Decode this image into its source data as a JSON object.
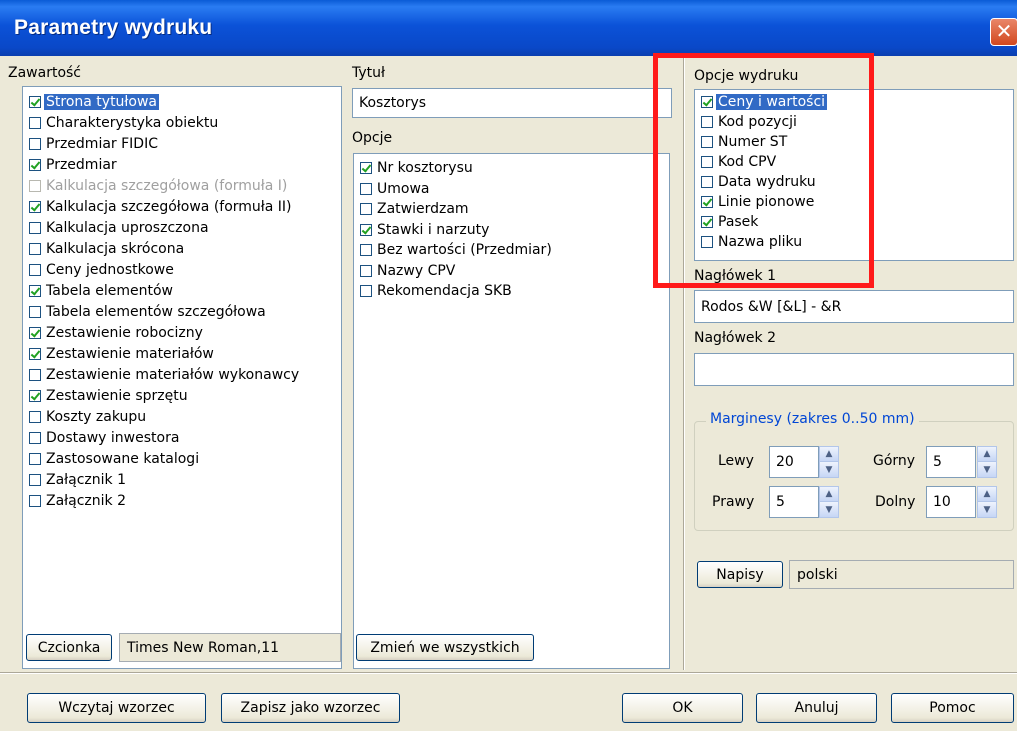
{
  "window": {
    "title": "Parametry wydruku",
    "close_glyph": "✕"
  },
  "zawartosc": {
    "label": "Zawartość",
    "items": [
      {
        "label": "Strona tytułowa",
        "checked": true,
        "selected": true,
        "disabled": false
      },
      {
        "label": "Charakterystyka obiektu",
        "checked": false,
        "selected": false,
        "disabled": false
      },
      {
        "label": "Przedmiar FIDIC",
        "checked": false,
        "selected": false,
        "disabled": false
      },
      {
        "label": "Przedmiar",
        "checked": true,
        "selected": false,
        "disabled": false
      },
      {
        "label": "Kalkulacja szczegółowa (formuła I)",
        "checked": false,
        "selected": false,
        "disabled": true
      },
      {
        "label": "Kalkulacja szczegółowa (formuła II)",
        "checked": true,
        "selected": false,
        "disabled": false
      },
      {
        "label": "Kalkulacja uproszczona",
        "checked": false,
        "selected": false,
        "disabled": false
      },
      {
        "label": "Kalkulacja skrócona",
        "checked": false,
        "selected": false,
        "disabled": false
      },
      {
        "label": "Ceny jednostkowe",
        "checked": false,
        "selected": false,
        "disabled": false
      },
      {
        "label": "Tabela elementów",
        "checked": true,
        "selected": false,
        "disabled": false
      },
      {
        "label": "Tabela elementów szczegółowa",
        "checked": false,
        "selected": false,
        "disabled": false
      },
      {
        "label": "Zestawienie robocizny",
        "checked": true,
        "selected": false,
        "disabled": false
      },
      {
        "label": "Zestawienie materiałów",
        "checked": true,
        "selected": false,
        "disabled": false
      },
      {
        "label": "Zestawienie materiałów wykonawcy",
        "checked": false,
        "selected": false,
        "disabled": false
      },
      {
        "label": "Zestawienie sprzętu",
        "checked": true,
        "selected": false,
        "disabled": false
      },
      {
        "label": "Koszty zakupu",
        "checked": false,
        "selected": false,
        "disabled": false
      },
      {
        "label": "Dostawy inwestora",
        "checked": false,
        "selected": false,
        "disabled": false
      },
      {
        "label": "Zastosowane katalogi",
        "checked": false,
        "selected": false,
        "disabled": false
      },
      {
        "label": "Załącznik 1",
        "checked": false,
        "selected": false,
        "disabled": false
      },
      {
        "label": "Załącznik 2",
        "checked": false,
        "selected": false,
        "disabled": false
      }
    ]
  },
  "tytul": {
    "label": "Tytuł",
    "value": "Kosztorys"
  },
  "opcje": {
    "label": "Opcje",
    "items": [
      {
        "label": "Nr kosztorysu",
        "checked": true
      },
      {
        "label": "Umowa",
        "checked": false
      },
      {
        "label": "Zatwierdzam",
        "checked": false
      },
      {
        "label": "Stawki i narzuty",
        "checked": true
      },
      {
        "label": "Bez wartości (Przedmiar)",
        "checked": false
      },
      {
        "label": "Nazwy CPV",
        "checked": false
      },
      {
        "label": "Rekomendacja SKB",
        "checked": false
      }
    ]
  },
  "opcje_wydruku": {
    "label": "Opcje wydruku",
    "items": [
      {
        "label": "Ceny i wartości",
        "checked": true,
        "selected": true
      },
      {
        "label": "Kod pozycji",
        "checked": false,
        "selected": false
      },
      {
        "label": "Numer ST",
        "checked": false,
        "selected": false
      },
      {
        "label": "Kod CPV",
        "checked": false,
        "selected": false
      },
      {
        "label": "Data wydruku",
        "checked": false,
        "selected": false
      },
      {
        "label": "Linie pionowe",
        "checked": true,
        "selected": false
      },
      {
        "label": "Pasek",
        "checked": true,
        "selected": false
      },
      {
        "label": "Nazwa pliku",
        "checked": false,
        "selected": false
      }
    ]
  },
  "naglowek1": {
    "label": "Nagłówek 1",
    "value": "Rodos &W [&L] - &R"
  },
  "naglowek2": {
    "label": "Nagłówek 2",
    "value": ""
  },
  "marginesy": {
    "title": "Marginesy (zakres 0..50 mm)",
    "lewy_label": "Lewy",
    "lewy_value": "20",
    "gorny_label": "Górny",
    "gorny_value": "5",
    "prawy_label": "Prawy",
    "prawy_value": "5",
    "dolny_label": "Dolny",
    "dolny_value": "10"
  },
  "napisy": {
    "button_label": "Napisy",
    "value": "polski"
  },
  "font": {
    "button_label": "Czcionka",
    "value": "Times New Roman,11"
  },
  "zmien_label": "Zmień we wszystkich",
  "footer": {
    "wczytaj_label": "Wczytaj wzorzec",
    "zapisz_label": "Zapisz jako wzorzec",
    "ok_label": "OK",
    "anuluj_label": "Anuluj",
    "pomoc_label": "Pomoc"
  },
  "colors": {
    "title_bar": "#0a52d8",
    "selection": "#316ac5",
    "highlight_box": "#ff1a1a",
    "check_mark": "#21a121"
  }
}
